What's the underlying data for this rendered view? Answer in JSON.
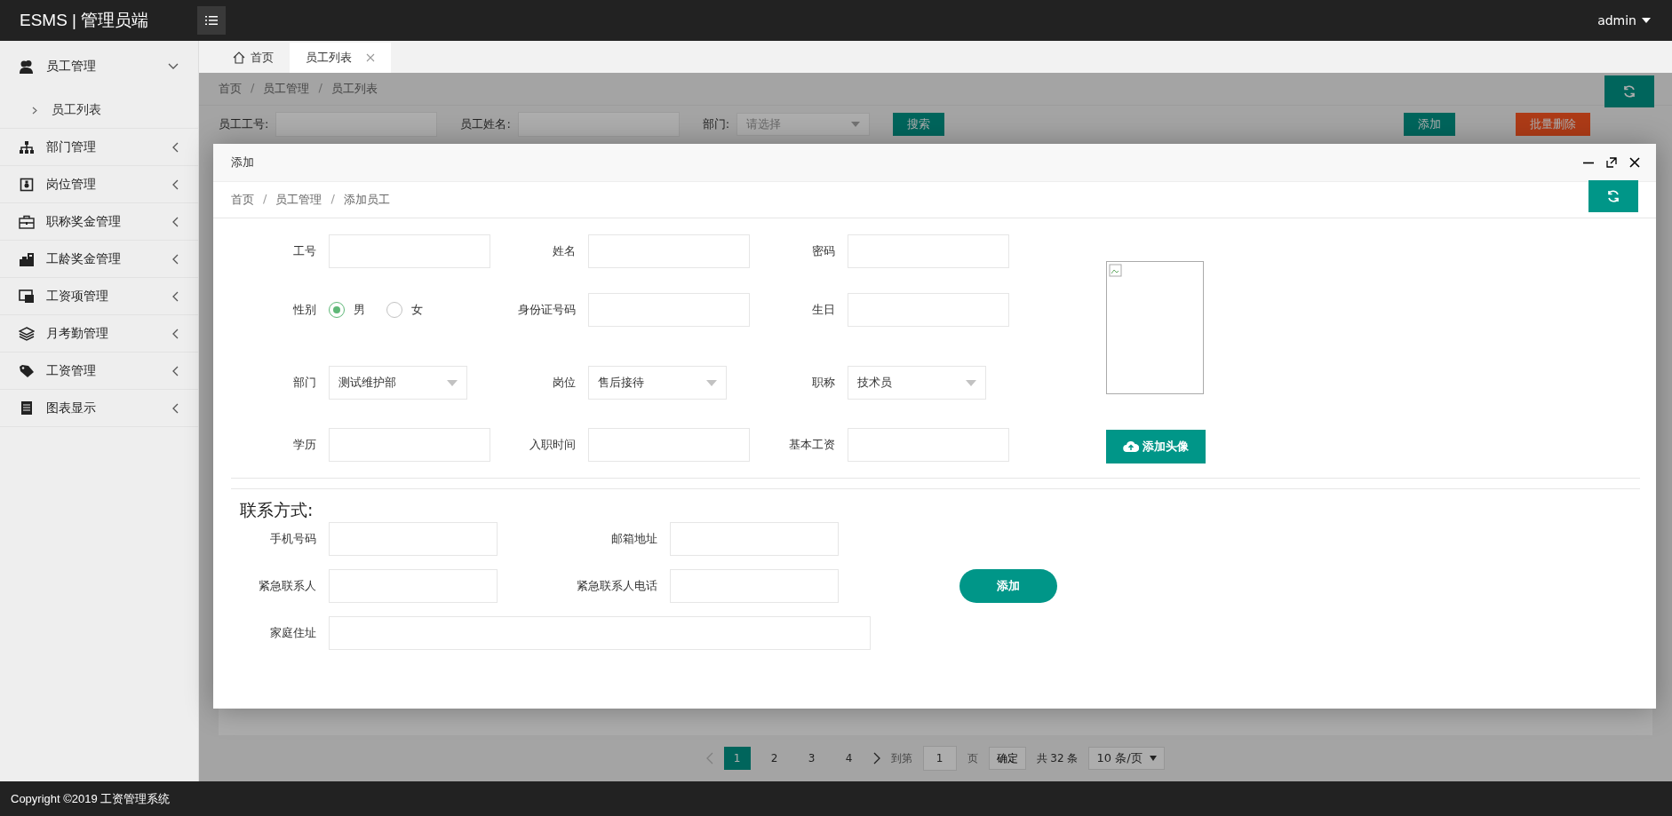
{
  "header": {
    "logo": "ESMS | 管理员端",
    "user": "admin"
  },
  "sidebar": {
    "items": [
      {
        "label": "员工管理",
        "expanded": true,
        "children": [
          {
            "label": "员工列表"
          }
        ]
      },
      {
        "label": "部门管理",
        "expanded": false
      },
      {
        "label": "岗位管理",
        "expanded": false
      },
      {
        "label": "职称奖金管理",
        "expanded": false
      },
      {
        "label": "工龄奖金管理",
        "expanded": false
      },
      {
        "label": "工资项管理",
        "expanded": false
      },
      {
        "label": "月考勤管理",
        "expanded": false
      },
      {
        "label": "工资管理",
        "expanded": false
      },
      {
        "label": "图表显示",
        "expanded": false
      }
    ]
  },
  "tabs": [
    {
      "label": "首页",
      "selected": false,
      "kind": "home"
    },
    {
      "label": "员工列表",
      "selected": true,
      "kind": "closable"
    }
  ],
  "breadcrumb": [
    {
      "label": "首页",
      "kind": "link"
    },
    {
      "label": "/",
      "kind": "separator"
    },
    {
      "label": "员工管理",
      "kind": "link"
    },
    {
      "label": "/",
      "kind": "separator"
    },
    {
      "label": "员工列表",
      "kind": "link"
    }
  ],
  "search": {
    "fields": [
      {
        "label": "员工工号:",
        "kind": "input"
      },
      {
        "label": "员工姓名:",
        "kind": "input"
      },
      {
        "label": "部门:",
        "kind": "select",
        "placeholder": "请选择"
      }
    ],
    "search_button": "搜索",
    "add_button": "添加",
    "delete_button": "批量删除"
  },
  "pagination": {
    "pages": [
      {
        "label": "1",
        "selected": true
      },
      {
        "label": "2",
        "selected": false
      },
      {
        "label": "3",
        "selected": false
      },
      {
        "label": "4",
        "selected": false
      }
    ],
    "goto_label": "到第",
    "goto_value": "1",
    "page_unit": "页",
    "confirm": "确定",
    "total": "共 32 条",
    "page_size": "10 条/页"
  },
  "modal": {
    "title": "添加",
    "breadcrumb": [
      {
        "label": "首页",
        "kind": "link"
      },
      {
        "label": "/",
        "kind": "separator"
      },
      {
        "label": "员工管理",
        "kind": "link"
      },
      {
        "label": "/",
        "kind": "separator"
      },
      {
        "label": "添加员工",
        "kind": "link"
      }
    ],
    "rows": [
      [
        {
          "label": "工号",
          "kind": "input"
        },
        {
          "label": "姓名",
          "kind": "input"
        },
        {
          "label": "密码",
          "kind": "input"
        }
      ],
      [
        {
          "label": "性别",
          "kind": "radio",
          "options": [
            {
              "label": "男",
              "selected": true
            },
            {
              "label": "女",
              "selected": false
            }
          ]
        },
        {
          "label": "身份证号码",
          "kind": "input"
        },
        {
          "label": "生日",
          "kind": "input"
        }
      ],
      [
        {
          "label": "部门",
          "kind": "select",
          "value": "测试维护部"
        },
        {
          "label": "岗位",
          "kind": "select",
          "value": "售后接待"
        },
        {
          "label": "职称",
          "kind": "select",
          "value": "技术员"
        }
      ],
      [
        {
          "label": "学历",
          "kind": "input"
        },
        {
          "label": "入职时间",
          "kind": "input"
        },
        {
          "label": "基本工资",
          "kind": "input"
        }
      ]
    ],
    "avatar_button": "添加头像",
    "contact_title": "联系方式:",
    "contact_rows": [
      [
        {
          "label": "手机号码",
          "kind": "input"
        },
        {
          "label": "邮箱地址",
          "kind": "input"
        }
      ],
      [
        {
          "label": "紧急联系人",
          "kind": "input"
        },
        {
          "label": "紧急联系人电话",
          "kind": "input"
        }
      ],
      [
        {
          "label": "家庭住址",
          "kind": "wide"
        }
      ]
    ],
    "submit": "添加"
  },
  "footer": "Copyright ©2019 工资管理系统"
}
